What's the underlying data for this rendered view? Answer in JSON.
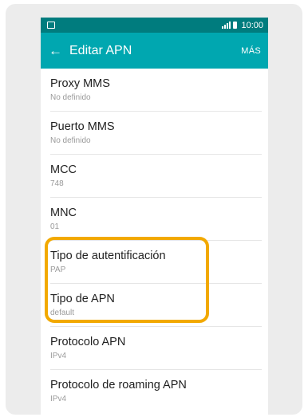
{
  "status_bar": {
    "time": "10:00"
  },
  "app_bar": {
    "title": "Editar APN",
    "more": "MÁS"
  },
  "settings": [
    {
      "title": "Proxy MMS",
      "value": "No definido"
    },
    {
      "title": "Puerto MMS",
      "value": "No definido"
    },
    {
      "title": "MCC",
      "value": "748"
    },
    {
      "title": "MNC",
      "value": "01"
    },
    {
      "title": "Tipo de autentificación",
      "value": "PAP"
    },
    {
      "title": "Tipo de APN",
      "value": "default"
    },
    {
      "title": "Protocolo APN",
      "value": "IPv4"
    },
    {
      "title": "Protocolo de roaming APN",
      "value": "IPv4"
    }
  ],
  "colors": {
    "status_bar": "#007c7e",
    "app_bar": "#00a7b0",
    "highlight": "#f2a900"
  }
}
